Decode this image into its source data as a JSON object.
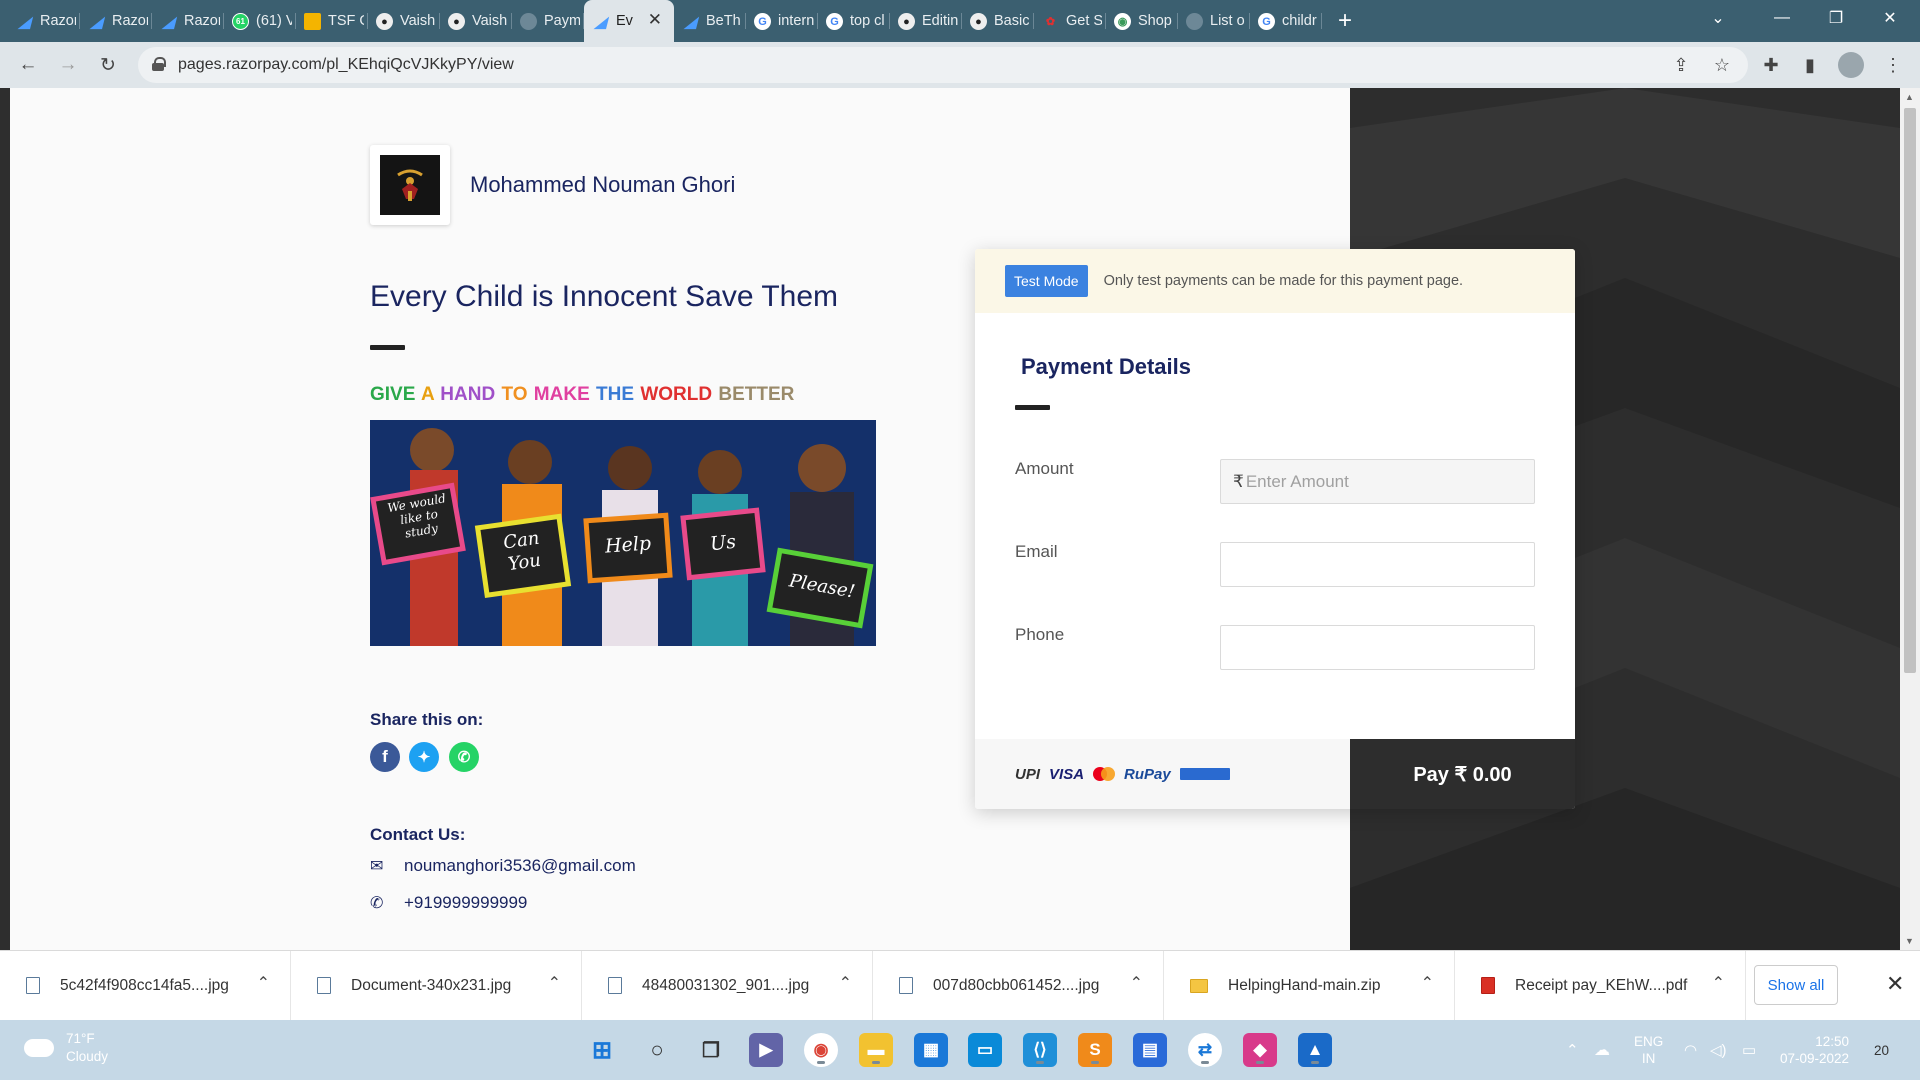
{
  "browser": {
    "tabs": [
      {
        "title": "Razor",
        "icon": "razorpay-icon"
      },
      {
        "title": "Razor",
        "icon": "razorpay-icon"
      },
      {
        "title": "Razor",
        "icon": "razorpay-icon"
      },
      {
        "title": "(61) V",
        "icon": "whatsapp-icon",
        "badge": "61"
      },
      {
        "title": "TSF G",
        "icon": "tsf-icon"
      },
      {
        "title": "Vaish",
        "icon": "github-icon"
      },
      {
        "title": "Vaish",
        "icon": "github-icon"
      },
      {
        "title": "Paym",
        "icon": "blank-icon"
      },
      {
        "title": "Ev",
        "icon": "razorpay-icon",
        "active": true
      },
      {
        "title": "BeTh",
        "icon": "razorpay-icon"
      },
      {
        "title": "intern",
        "icon": "google-icon"
      },
      {
        "title": "top cl",
        "icon": "google-icon"
      },
      {
        "title": "Editin",
        "icon": "github-icon"
      },
      {
        "title": "Basic",
        "icon": "github-icon"
      },
      {
        "title": "Get S",
        "icon": "red-icon"
      },
      {
        "title": "Shop",
        "icon": "globe-icon"
      },
      {
        "title": "List o",
        "icon": "blank-icon"
      },
      {
        "title": "childr",
        "icon": "google-icon"
      }
    ],
    "url": "pages.razorpay.com/pl_KEhqiQcVJKkyPY/view"
  },
  "page": {
    "merchant_name": "Mohammed Nouman Ghori",
    "title": "Every Child is Innocent Save Them",
    "tagline_words": [
      {
        "text": "GIVE",
        "color": "#2aa84a"
      },
      {
        "text": "A",
        "color": "#e8a010"
      },
      {
        "text": "HAND",
        "color": "#a050c8"
      },
      {
        "text": "TO",
        "color": "#f09020"
      },
      {
        "text": "MAKE",
        "color": "#e040a0"
      },
      {
        "text": "THE",
        "color": "#3a7bd5"
      },
      {
        "text": "WORLD",
        "color": "#e03030"
      },
      {
        "text": "BETTER",
        "color": "#9a8a6a"
      }
    ],
    "banner_signs": [
      "We would like to study",
      "Can You",
      "Help",
      "Us",
      "Please!"
    ],
    "share_label": "Share this on:",
    "contact_label": "Contact Us:",
    "email": "noumanghori3536@gmail.com",
    "phone": "+919999999999"
  },
  "payment": {
    "test_badge": "Test Mode",
    "test_note": "Only test payments can be made for this payment page.",
    "title": "Payment Details",
    "amount_label": "Amount",
    "amount_placeholder": "Enter Amount",
    "currency_symbol": "₹",
    "email_label": "Email",
    "phone_label": "Phone",
    "pay_button": "Pay ₹ 0.00",
    "payment_logos": [
      "UPI",
      "VISA",
      "RuPay"
    ]
  },
  "downloads": {
    "items": [
      "5c42f4f908cc14fa5....jpg",
      "Document-340x231.jpg",
      "48480031302_901....jpg",
      "007d80cbb061452....jpg",
      "HelpingHand-main.zip",
      "Receipt pay_KEhW....pdf"
    ],
    "show_all": "Show all"
  },
  "taskbar": {
    "temperature": "71°F",
    "weather": "Cloudy",
    "language_top": "ENG",
    "language_bottom": "IN",
    "time": "12:50",
    "date": "07-09-2022",
    "notification_count": "20"
  }
}
